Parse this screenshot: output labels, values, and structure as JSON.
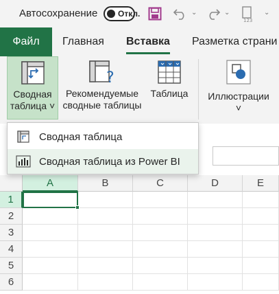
{
  "titlebar": {
    "autosave_label": "Автосохранение",
    "autosave_state": "Откл.",
    "icons": [
      "save-icon",
      "undo-icon",
      "redo-icon",
      "spelling-icon"
    ]
  },
  "tabs": [
    {
      "label": "Файл"
    },
    {
      "label": "Главная"
    },
    {
      "label": "Вставка"
    },
    {
      "label": "Разметка страни"
    }
  ],
  "ribbon": {
    "pivot": {
      "line1": "Сводная",
      "line2": "таблица ˅"
    },
    "recommended": {
      "line1": "Рекомендуемые",
      "line2": "сводные таблицы"
    },
    "table": {
      "line1": "Таблица"
    },
    "illustrations": {
      "line1": "Иллюстрации",
      "line2": "˅"
    }
  },
  "dropdown": {
    "items": [
      {
        "label": "Сводная таблица"
      },
      {
        "label": "Сводная таблица из Power BI"
      }
    ]
  },
  "grid": {
    "columns": [
      "A",
      "B",
      "C",
      "D",
      "E"
    ],
    "rows": [
      "1",
      "2",
      "3",
      "4",
      "5",
      "6"
    ],
    "selected_cell": "A1"
  },
  "colors": {
    "accent": "#217346",
    "ribbon_bg": "#f3f3f3",
    "active_button": "#c6e2c9"
  }
}
